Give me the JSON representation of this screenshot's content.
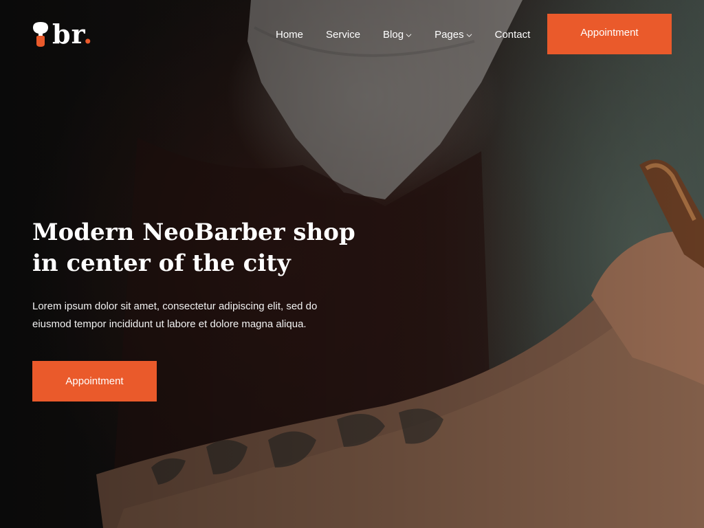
{
  "brand": {
    "logo_text": "br",
    "logo_dot": ".",
    "accent_color": "#ea5a2b"
  },
  "nav": {
    "items": [
      {
        "label": "Home",
        "has_dropdown": false
      },
      {
        "label": "Service",
        "has_dropdown": false
      },
      {
        "label": "Blog",
        "has_dropdown": true
      },
      {
        "label": "Pages",
        "has_dropdown": true
      },
      {
        "label": "Contact",
        "has_dropdown": false
      }
    ],
    "cta_label": "Appointment"
  },
  "hero": {
    "title_line1": "Modern NeoBarber shop",
    "title_line2": "in center of the city",
    "description": "Lorem ipsum dolor sit amet, consectetur adipiscing elit, sed do eiusmod tempor incididunt ut labore et dolore magna aliqua.",
    "cta_label": "Appointment"
  },
  "icons": {
    "logo": "shaving-brush-icon",
    "dropdown": "chevron-down-icon"
  }
}
